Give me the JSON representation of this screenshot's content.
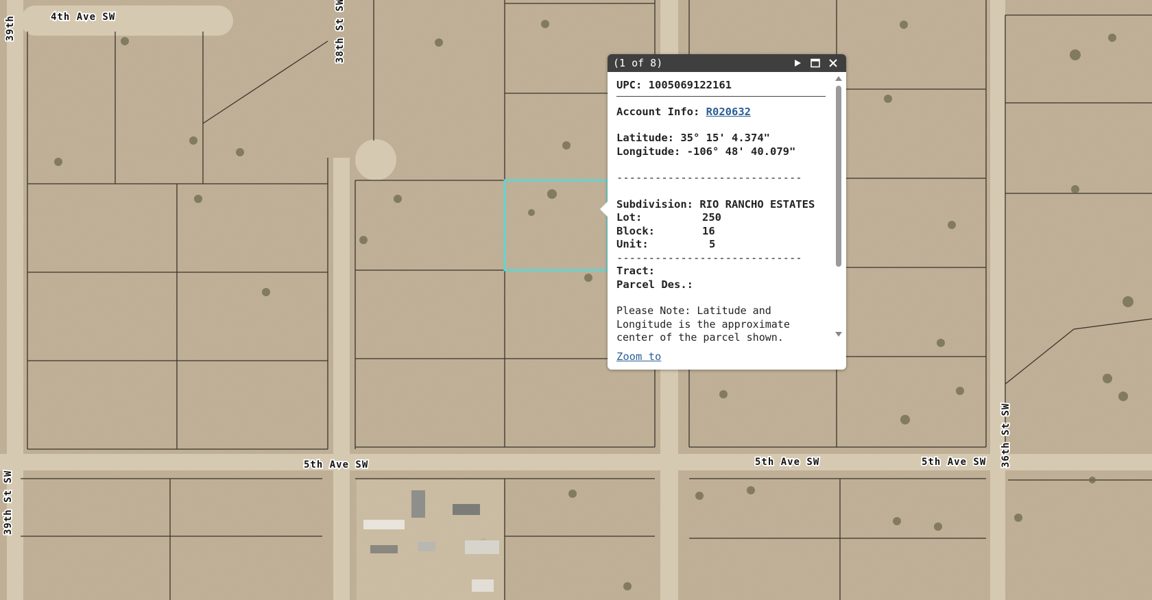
{
  "map": {
    "road_labels": [
      {
        "id": "4th-ave-sw-label",
        "text": "4th Ave SW"
      },
      {
        "id": "38th-st-label",
        "text": "38th St SW"
      },
      {
        "id": "39th-st-top-label",
        "text": "39th"
      },
      {
        "id": "39th-st-bottom-label",
        "text": "39th St SW"
      },
      {
        "id": "5th-ave-sw-label-1",
        "text": "5th Ave SW"
      },
      {
        "id": "5th-ave-sw-label-2",
        "text": "5th Ave SW"
      },
      {
        "id": "5th-ave-sw-label-3",
        "text": "5th Ave SW"
      },
      {
        "id": "36th-st-label",
        "text": "36th St SW"
      }
    ],
    "colors": {
      "terrain": "#c4b49a",
      "parcel_line": "#3a332a",
      "highlight": "#5fd6d4",
      "road": "#d8ccb6"
    }
  },
  "popup": {
    "counter": "(1 of 8)",
    "next_icon": "play-triangle",
    "maximize_icon": "window-square",
    "close_icon": "x-cross",
    "upc_label": "UPC:",
    "upc_value": "1005069122161",
    "account_label": "Account Info:",
    "account_value": "R020632",
    "latitude_label": "Latitude:",
    "latitude_value": "35° 15' 4.374\"",
    "longitude_label": "Longitude:",
    "longitude_value": "-106° 48' 40.079\"",
    "separator": "-----------------------------",
    "subdivision_label": "Subdivision:",
    "subdivision_value": "RIO RANCHO ESTATES",
    "lot_label": "Lot:",
    "lot_value": "250",
    "block_label": "Block:",
    "block_value": "16",
    "unit_label": "Unit:",
    "unit_value": "5",
    "tract_label": "Tract:",
    "parcel_des_label": "Parcel Des.:",
    "note": "Please Note: Latitude and Longitude is the approximate center of the parcel shown.",
    "zoom_to": "Zoom to"
  }
}
